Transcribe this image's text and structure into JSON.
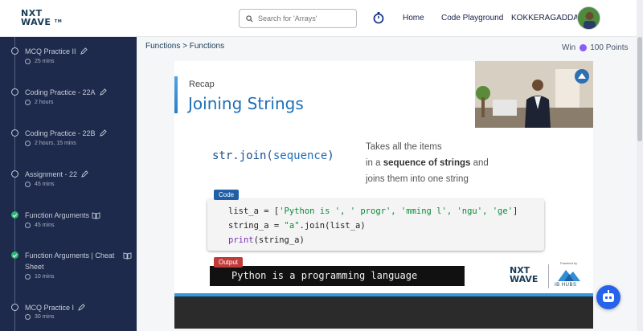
{
  "header": {
    "logo_line1": "NXT",
    "logo_line2": "WAVE",
    "logo_tm": "TM",
    "search_placeholder": "Search for 'Arrays'",
    "nav_home": "Home",
    "nav_playground": "Code Playground",
    "user_name": "KOKKERAGADDA"
  },
  "sidebar": {
    "items": [
      {
        "title": "MCQ Practice II",
        "meta": "25 mins",
        "status": "pending",
        "icon": "edit-icon"
      },
      {
        "title": "Coding Practice - 22A",
        "meta": "2 hours",
        "status": "pending",
        "icon": "edit-icon"
      },
      {
        "title": "Coding Practice - 22B",
        "meta": "2 hours, 15 mins",
        "status": "pending",
        "icon": "edit-icon"
      },
      {
        "title": "Assignment - 22",
        "meta": "45 mins",
        "status": "pending",
        "icon": "edit-icon"
      },
      {
        "title": "Function Arguments",
        "meta": "45 mins",
        "status": "completed",
        "icon": "book-icon"
      },
      {
        "title": "Function Arguments | Cheat Sheet",
        "meta": "10 mins",
        "status": "completed",
        "icon": "book-icon"
      },
      {
        "title": "MCQ Practice I",
        "meta": "30 mins",
        "status": "pending",
        "icon": "edit-icon"
      }
    ]
  },
  "content": {
    "breadcrumb": "Functions > Functions",
    "win_label": "Win",
    "points": "100 Points"
  },
  "slide": {
    "recap": "Recap",
    "title": "Joining Strings",
    "syntax_fn": "str.join(",
    "syntax_arg": "sequence",
    "syntax_end": ")",
    "desc_1": "Takes all the items",
    "desc_2a": "in a ",
    "desc_2b": "sequence of strings",
    "desc_2c": " and",
    "desc_3": "joins them into one string",
    "code_tag": "Code",
    "code_line1_a": "list_a = [",
    "code_line1_b": "'Python is ', ' progr', 'mming l', 'ngu', 'ge'",
    "code_line1_c": "]",
    "code_line2_a": "string_a = ",
    "code_line2_b": "\"a\"",
    "code_line2_c": ".join(list_a)",
    "code_line3_fn": "print",
    "code_line3_b": "(string_a)",
    "output_tag": "Output",
    "output_text": "Python is a programming language",
    "brand_nxt1": "NXT",
    "brand_nxt2": "WAVE",
    "brand_powered": "Powered by",
    "brand_ib": "IB HUBS"
  }
}
